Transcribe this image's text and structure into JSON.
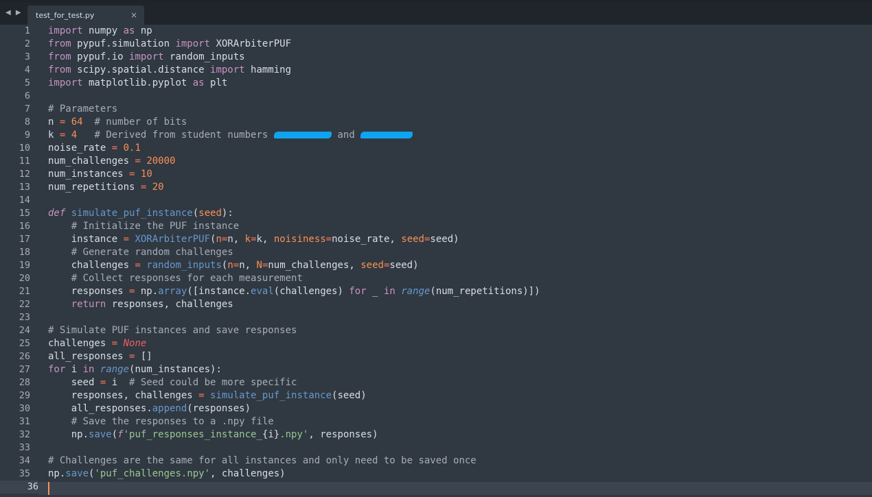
{
  "tabbar": {
    "nav_arrows": "◀ ▶",
    "tab_title": "test_for_test.py",
    "close_glyph": "×"
  },
  "editor": {
    "active_line": 36,
    "lines": [
      {
        "n": "1",
        "tokens": [
          [
            "kw",
            "import"
          ],
          [
            "pl",
            " numpy "
          ],
          [
            "kw",
            "as"
          ],
          [
            "pl",
            " np"
          ]
        ]
      },
      {
        "n": "2",
        "tokens": [
          [
            "kw",
            "from"
          ],
          [
            "pl",
            " pypuf.simulation "
          ],
          [
            "kw",
            "import"
          ],
          [
            "pl",
            " XORArbiterPUF"
          ]
        ]
      },
      {
        "n": "3",
        "tokens": [
          [
            "kw",
            "from"
          ],
          [
            "pl",
            " pypuf.io "
          ],
          [
            "kw",
            "import"
          ],
          [
            "pl",
            " random_inputs"
          ]
        ]
      },
      {
        "n": "4",
        "tokens": [
          [
            "kw",
            "from"
          ],
          [
            "pl",
            " scipy.spatial.distance "
          ],
          [
            "kw",
            "import"
          ],
          [
            "pl",
            " hamming"
          ]
        ]
      },
      {
        "n": "5",
        "tokens": [
          [
            "kw",
            "import"
          ],
          [
            "pl",
            " matplotlib.pyplot "
          ],
          [
            "kw",
            "as"
          ],
          [
            "pl",
            " plt"
          ]
        ]
      },
      {
        "n": "6",
        "tokens": []
      },
      {
        "n": "7",
        "tokens": [
          [
            "cm",
            "# Parameters"
          ]
        ]
      },
      {
        "n": "8",
        "tokens": [
          [
            "pl",
            "n "
          ],
          [
            "op",
            "="
          ],
          [
            "pl",
            " "
          ],
          [
            "num",
            "64"
          ],
          [
            "pl",
            "  "
          ],
          [
            "cm",
            "# number of bits"
          ]
        ]
      },
      {
        "n": "9",
        "tokens": [
          [
            "pl",
            "k "
          ],
          [
            "op",
            "="
          ],
          [
            "pl",
            " "
          ],
          [
            "num",
            "4"
          ],
          [
            "pl",
            "   "
          ],
          [
            "cm",
            "# Derived from student numbers "
          ],
          [
            "redact",
            "          "
          ],
          [
            "cm",
            " and "
          ],
          [
            "redact",
            "         "
          ]
        ]
      },
      {
        "n": "10",
        "tokens": [
          [
            "pl",
            "noise_rate "
          ],
          [
            "op",
            "="
          ],
          [
            "pl",
            " "
          ],
          [
            "num",
            "0.1"
          ]
        ]
      },
      {
        "n": "11",
        "tokens": [
          [
            "pl",
            "num_challenges "
          ],
          [
            "op",
            "="
          ],
          [
            "pl",
            " "
          ],
          [
            "num",
            "20000"
          ]
        ]
      },
      {
        "n": "12",
        "tokens": [
          [
            "pl",
            "num_instances "
          ],
          [
            "op",
            "="
          ],
          [
            "pl",
            " "
          ],
          [
            "num",
            "10"
          ]
        ]
      },
      {
        "n": "13",
        "tokens": [
          [
            "pl",
            "num_repetitions "
          ],
          [
            "op",
            "="
          ],
          [
            "pl",
            " "
          ],
          [
            "num",
            "20"
          ]
        ]
      },
      {
        "n": "14",
        "tokens": []
      },
      {
        "n": "15",
        "tokens": [
          [
            "def",
            "def"
          ],
          [
            "pl",
            " "
          ],
          [
            "fn",
            "simulate_puf_instance"
          ],
          [
            "pl",
            "("
          ],
          [
            "param",
            "seed"
          ],
          [
            "pl",
            "):"
          ]
        ]
      },
      {
        "n": "16",
        "tokens": [
          [
            "pl",
            "    "
          ],
          [
            "cm",
            "# Initialize the PUF instance"
          ]
        ]
      },
      {
        "n": "17",
        "tokens": [
          [
            "pl",
            "    instance "
          ],
          [
            "op",
            "="
          ],
          [
            "pl",
            " "
          ],
          [
            "call",
            "XORArbiterPUF"
          ],
          [
            "pl",
            "("
          ],
          [
            "param",
            "n"
          ],
          [
            "op",
            "="
          ],
          [
            "pl",
            "n, "
          ],
          [
            "param",
            "k"
          ],
          [
            "op",
            "="
          ],
          [
            "pl",
            "k, "
          ],
          [
            "param",
            "noisiness"
          ],
          [
            "op",
            "="
          ],
          [
            "pl",
            "noise_rate, "
          ],
          [
            "param",
            "seed"
          ],
          [
            "op",
            "="
          ],
          [
            "pl",
            "seed)"
          ]
        ]
      },
      {
        "n": "18",
        "tokens": [
          [
            "pl",
            "    "
          ],
          [
            "cm",
            "# Generate random challenges"
          ]
        ]
      },
      {
        "n": "19",
        "tokens": [
          [
            "pl",
            "    challenges "
          ],
          [
            "op",
            "="
          ],
          [
            "pl",
            " "
          ],
          [
            "call",
            "random_inputs"
          ],
          [
            "pl",
            "("
          ],
          [
            "param",
            "n"
          ],
          [
            "op",
            "="
          ],
          [
            "pl",
            "n, "
          ],
          [
            "param",
            "N"
          ],
          [
            "op",
            "="
          ],
          [
            "pl",
            "num_challenges, "
          ],
          [
            "param",
            "seed"
          ],
          [
            "op",
            "="
          ],
          [
            "pl",
            "seed)"
          ]
        ]
      },
      {
        "n": "20",
        "tokens": [
          [
            "pl",
            "    "
          ],
          [
            "cm",
            "# Collect responses for each measurement"
          ]
        ]
      },
      {
        "n": "21",
        "tokens": [
          [
            "pl",
            "    responses "
          ],
          [
            "op",
            "="
          ],
          [
            "pl",
            " np."
          ],
          [
            "call",
            "array"
          ],
          [
            "pl",
            "([instance."
          ],
          [
            "call",
            "eval"
          ],
          [
            "pl",
            "(challenges) "
          ],
          [
            "kw",
            "for"
          ],
          [
            "pl",
            " _ "
          ],
          [
            "kw",
            "in"
          ],
          [
            "pl",
            " "
          ],
          [
            "builtin",
            "range"
          ],
          [
            "pl",
            "(num_repetitions)])"
          ]
        ]
      },
      {
        "n": "22",
        "tokens": [
          [
            "pl",
            "    "
          ],
          [
            "kw",
            "return"
          ],
          [
            "pl",
            " responses, challenges"
          ]
        ]
      },
      {
        "n": "23",
        "tokens": []
      },
      {
        "n": "24",
        "tokens": [
          [
            "cm",
            "# Simulate PUF instances and save responses"
          ]
        ]
      },
      {
        "n": "25",
        "tokens": [
          [
            "pl",
            "challenges "
          ],
          [
            "op",
            "="
          ],
          [
            "pl",
            " "
          ],
          [
            "const",
            "None"
          ]
        ]
      },
      {
        "n": "26",
        "tokens": [
          [
            "pl",
            "all_responses "
          ],
          [
            "op",
            "="
          ],
          [
            "pl",
            " []"
          ]
        ]
      },
      {
        "n": "27",
        "tokens": [
          [
            "kw",
            "for"
          ],
          [
            "pl",
            " i "
          ],
          [
            "kw",
            "in"
          ],
          [
            "pl",
            " "
          ],
          [
            "builtin",
            "range"
          ],
          [
            "pl",
            "(num_instances):"
          ]
        ]
      },
      {
        "n": "28",
        "tokens": [
          [
            "pl",
            "    seed "
          ],
          [
            "op",
            "="
          ],
          [
            "pl",
            " i  "
          ],
          [
            "cm",
            "# Seed could be more specific"
          ]
        ]
      },
      {
        "n": "29",
        "tokens": [
          [
            "pl",
            "    responses, challenges "
          ],
          [
            "op",
            "="
          ],
          [
            "pl",
            " "
          ],
          [
            "call",
            "simulate_puf_instance"
          ],
          [
            "pl",
            "(seed)"
          ]
        ]
      },
      {
        "n": "30",
        "tokens": [
          [
            "pl",
            "    all_responses."
          ],
          [
            "call",
            "append"
          ],
          [
            "pl",
            "(responses)"
          ]
        ]
      },
      {
        "n": "31",
        "tokens": [
          [
            "pl",
            "    "
          ],
          [
            "cm",
            "# Save the responses to a .npy file"
          ]
        ]
      },
      {
        "n": "32",
        "tokens": [
          [
            "pl",
            "    np."
          ],
          [
            "call",
            "save"
          ],
          [
            "pl",
            "("
          ],
          [
            "def",
            "f"
          ],
          [
            "str",
            "'puf_responses_instance_"
          ],
          [
            "pl",
            "{i}"
          ],
          [
            "str",
            ".npy'"
          ],
          [
            "pl",
            ", responses)"
          ]
        ]
      },
      {
        "n": "33",
        "tokens": []
      },
      {
        "n": "34",
        "tokens": [
          [
            "cm",
            "# Challenges are the same for all instances and only need to be saved once"
          ]
        ]
      },
      {
        "n": "35",
        "tokens": [
          [
            "pl",
            "np."
          ],
          [
            "call",
            "save"
          ],
          [
            "pl",
            "("
          ],
          [
            "str",
            "'puf_challenges.npy'"
          ],
          [
            "pl",
            ", challenges)"
          ]
        ]
      },
      {
        "n": "36",
        "tokens": []
      }
    ]
  },
  "colors": {
    "background": "#303841",
    "keyword": "#c594c5",
    "comment": "#a7adba",
    "number": "#f99157",
    "operator": "#f97b58",
    "function": "#6699cc",
    "string": "#99c794",
    "constant": "#ec5f67",
    "redaction": "#0ea5f0"
  }
}
